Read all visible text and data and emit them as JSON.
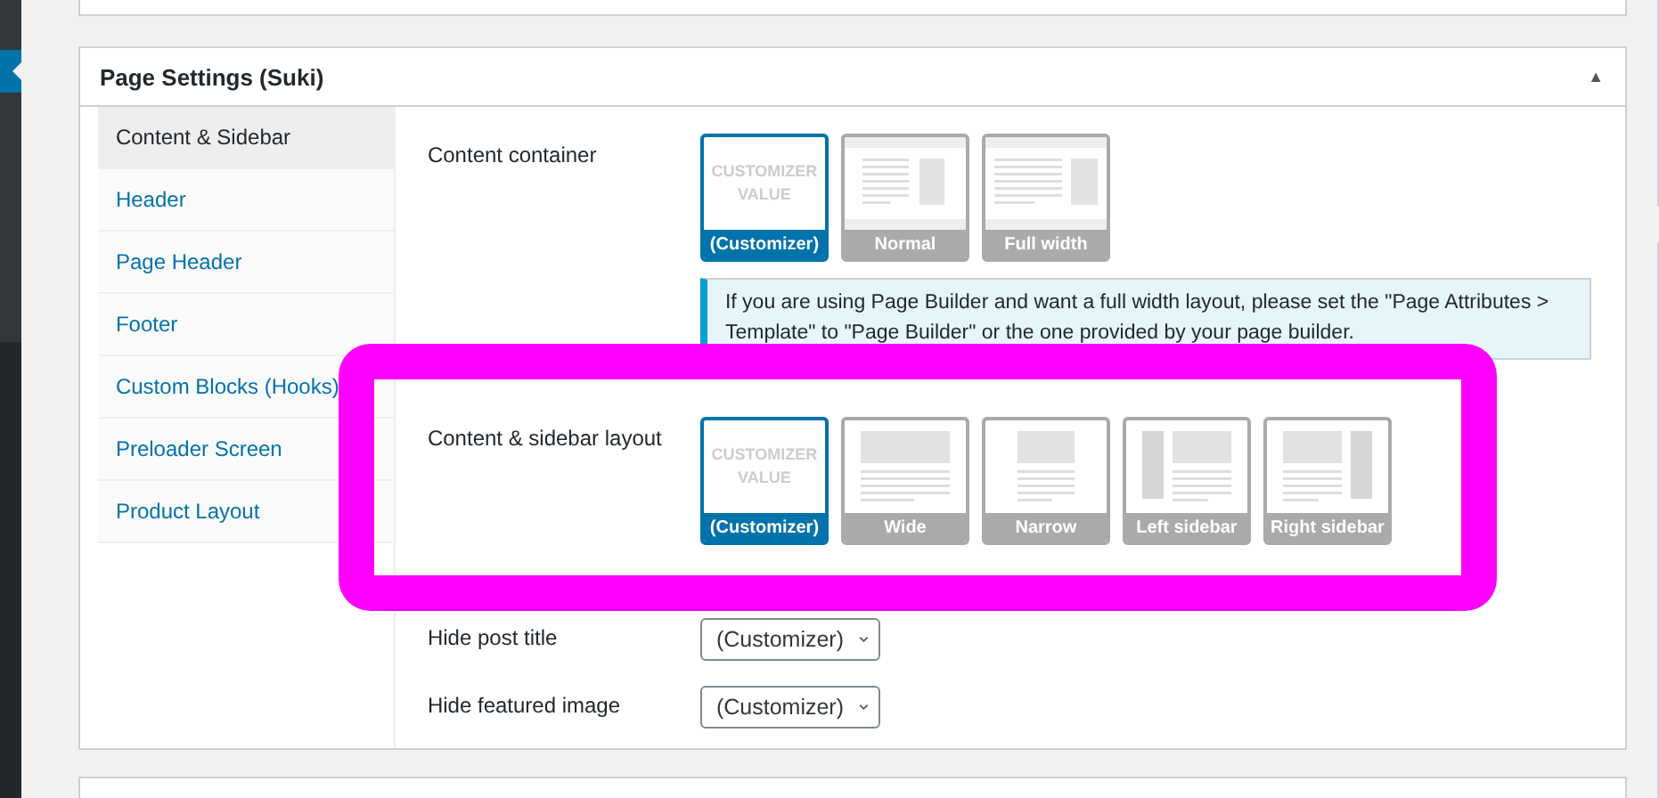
{
  "metabox": {
    "title": "Page Settings (Suki)",
    "toggle": "▲",
    "expanded": true
  },
  "tabs": [
    {
      "label": "Content & Sidebar",
      "selected": true
    },
    {
      "label": "Header",
      "selected": false
    },
    {
      "label": "Page Header",
      "selected": false
    },
    {
      "label": "Footer",
      "selected": false
    },
    {
      "label": "Custom Blocks (Hooks)",
      "selected": false
    },
    {
      "label": "Preloader Screen",
      "selected": false
    },
    {
      "label": "Product Layout",
      "selected": false
    }
  ],
  "settings": [
    {
      "kind": "images",
      "label": "Content container",
      "options": [
        {
          "kind": "customizer",
          "thumb_text": "CUSTOMIZER VALUE",
          "label": "(Customizer)",
          "selected": true
        },
        {
          "kind": "normal",
          "label": "Normal",
          "selected": false
        },
        {
          "kind": "full-width",
          "label": "Full width",
          "selected": false
        }
      ],
      "notice": "If you are using Page Builder and want a full width layout, please set the \"Page Attributes > Template\" to \"Page Builder\" or the one provided by your page builder."
    },
    {
      "kind": "images",
      "label": "Content & sidebar layout",
      "highlighted": true,
      "options": [
        {
          "kind": "customizer",
          "thumb_text": "CUSTOMIZER VALUE",
          "label": "(Customizer)",
          "selected": true
        },
        {
          "kind": "wide",
          "label": "Wide",
          "selected": false
        },
        {
          "kind": "narrow",
          "label": "Narrow",
          "selected": false
        },
        {
          "kind": "left-sidebar",
          "label": "Left sidebar",
          "selected": false
        },
        {
          "kind": "right-sidebar",
          "label": "Right sidebar",
          "selected": false
        }
      ]
    },
    {
      "kind": "select",
      "label": "Hide post title",
      "value": "(Customizer)"
    },
    {
      "kind": "select",
      "label": "Hide featured image",
      "value": "(Customizer)"
    }
  ]
}
